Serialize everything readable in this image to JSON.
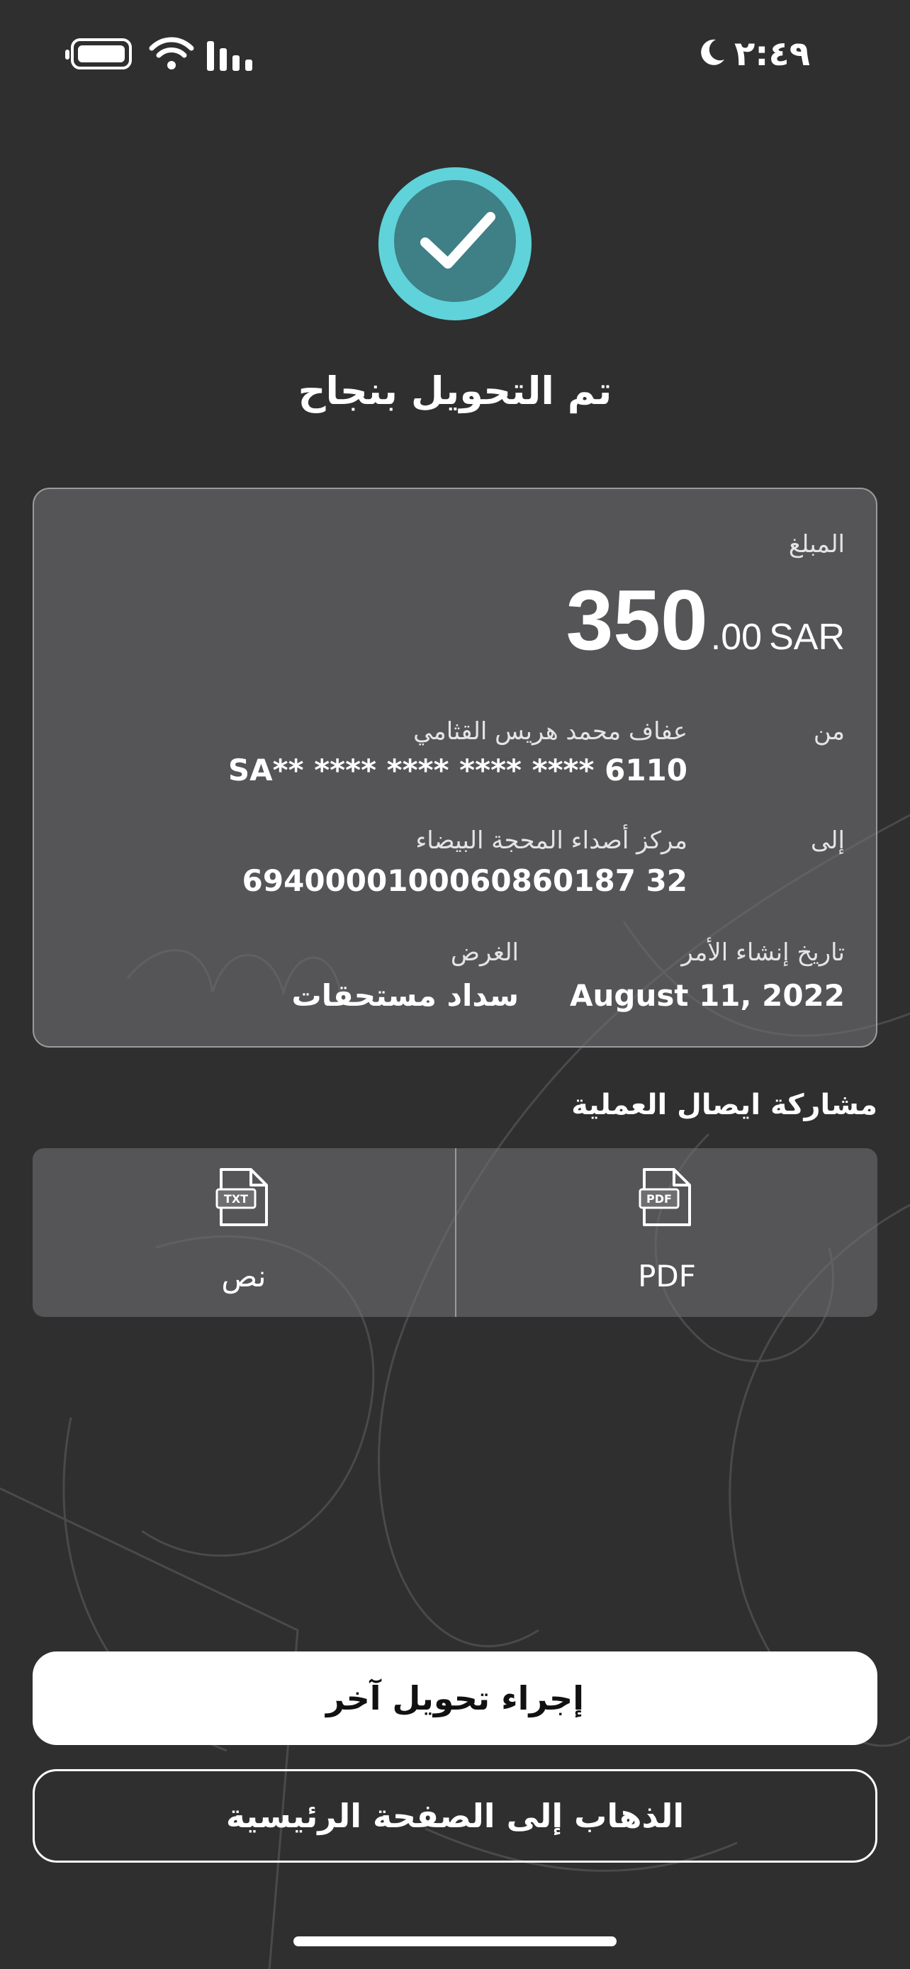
{
  "status_bar": {
    "time": "٢:٤٩"
  },
  "success": {
    "title": "تم التحويل بنجاح"
  },
  "details": {
    "amount_label": "المبلغ",
    "amount_whole": "350",
    "amount_fraction": ".00",
    "currency": "SAR",
    "from_label": "من",
    "from_name": "عفاف محمد هريس  القثامي",
    "from_account": "SA** **** **** **** **** 6110",
    "to_label": "إلى",
    "to_name": "مركز أصداء المحجة البيضاء",
    "to_account": "6940000100060860187 32",
    "order_date_label": "تاريخ إنشاء الأمر",
    "order_date": "August 11, 2022",
    "purpose_label": "الغرض",
    "purpose": "سداد مستحقات"
  },
  "share": {
    "title": "مشاركة ايصال العملية",
    "pdf_label": "PDF",
    "text_label": "نص",
    "pdf_icon_text": "PDF",
    "txt_icon_text": "TXT"
  },
  "actions": {
    "new_transfer": "إجراء تحويل آخر",
    "go_home": "الذهاب إلى الصفحة الرئيسية"
  },
  "colors": {
    "background": "#2f2f30",
    "card": "#6e6e70",
    "success_ring": "#5fd3d9",
    "success_fill": "#3f7f86"
  }
}
